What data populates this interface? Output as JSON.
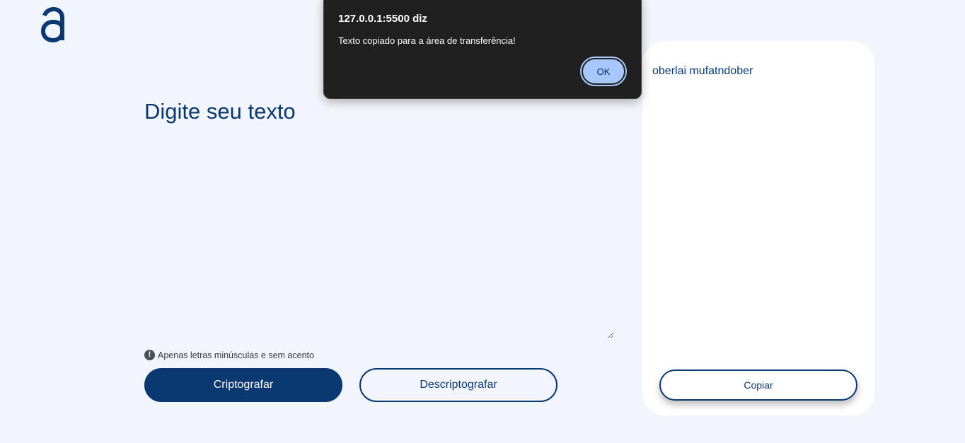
{
  "logo": {
    "icon": "alura-a-logo-icon",
    "color": "#0a3871"
  },
  "input": {
    "title": "Digite seu texto",
    "value": ""
  },
  "hint": {
    "icon": "exclamation-circle-icon",
    "text": "Apenas letras minúsculas e sem acento"
  },
  "buttons": {
    "encrypt_label": "Criptografar",
    "decrypt_label": "Descriptografar"
  },
  "output": {
    "text": "oberlai mufatndober",
    "copy_label": "Copiar"
  },
  "dialog": {
    "origin": "127.0.0.1:5500 diz",
    "message": "Texto copiado para a área de transferência!",
    "ok_label": "OK"
  },
  "colors": {
    "primary": "#0a3871",
    "background": "#f3f5fc",
    "dialog_bg": "#202020",
    "dialog_button": "#a8c7fa"
  }
}
